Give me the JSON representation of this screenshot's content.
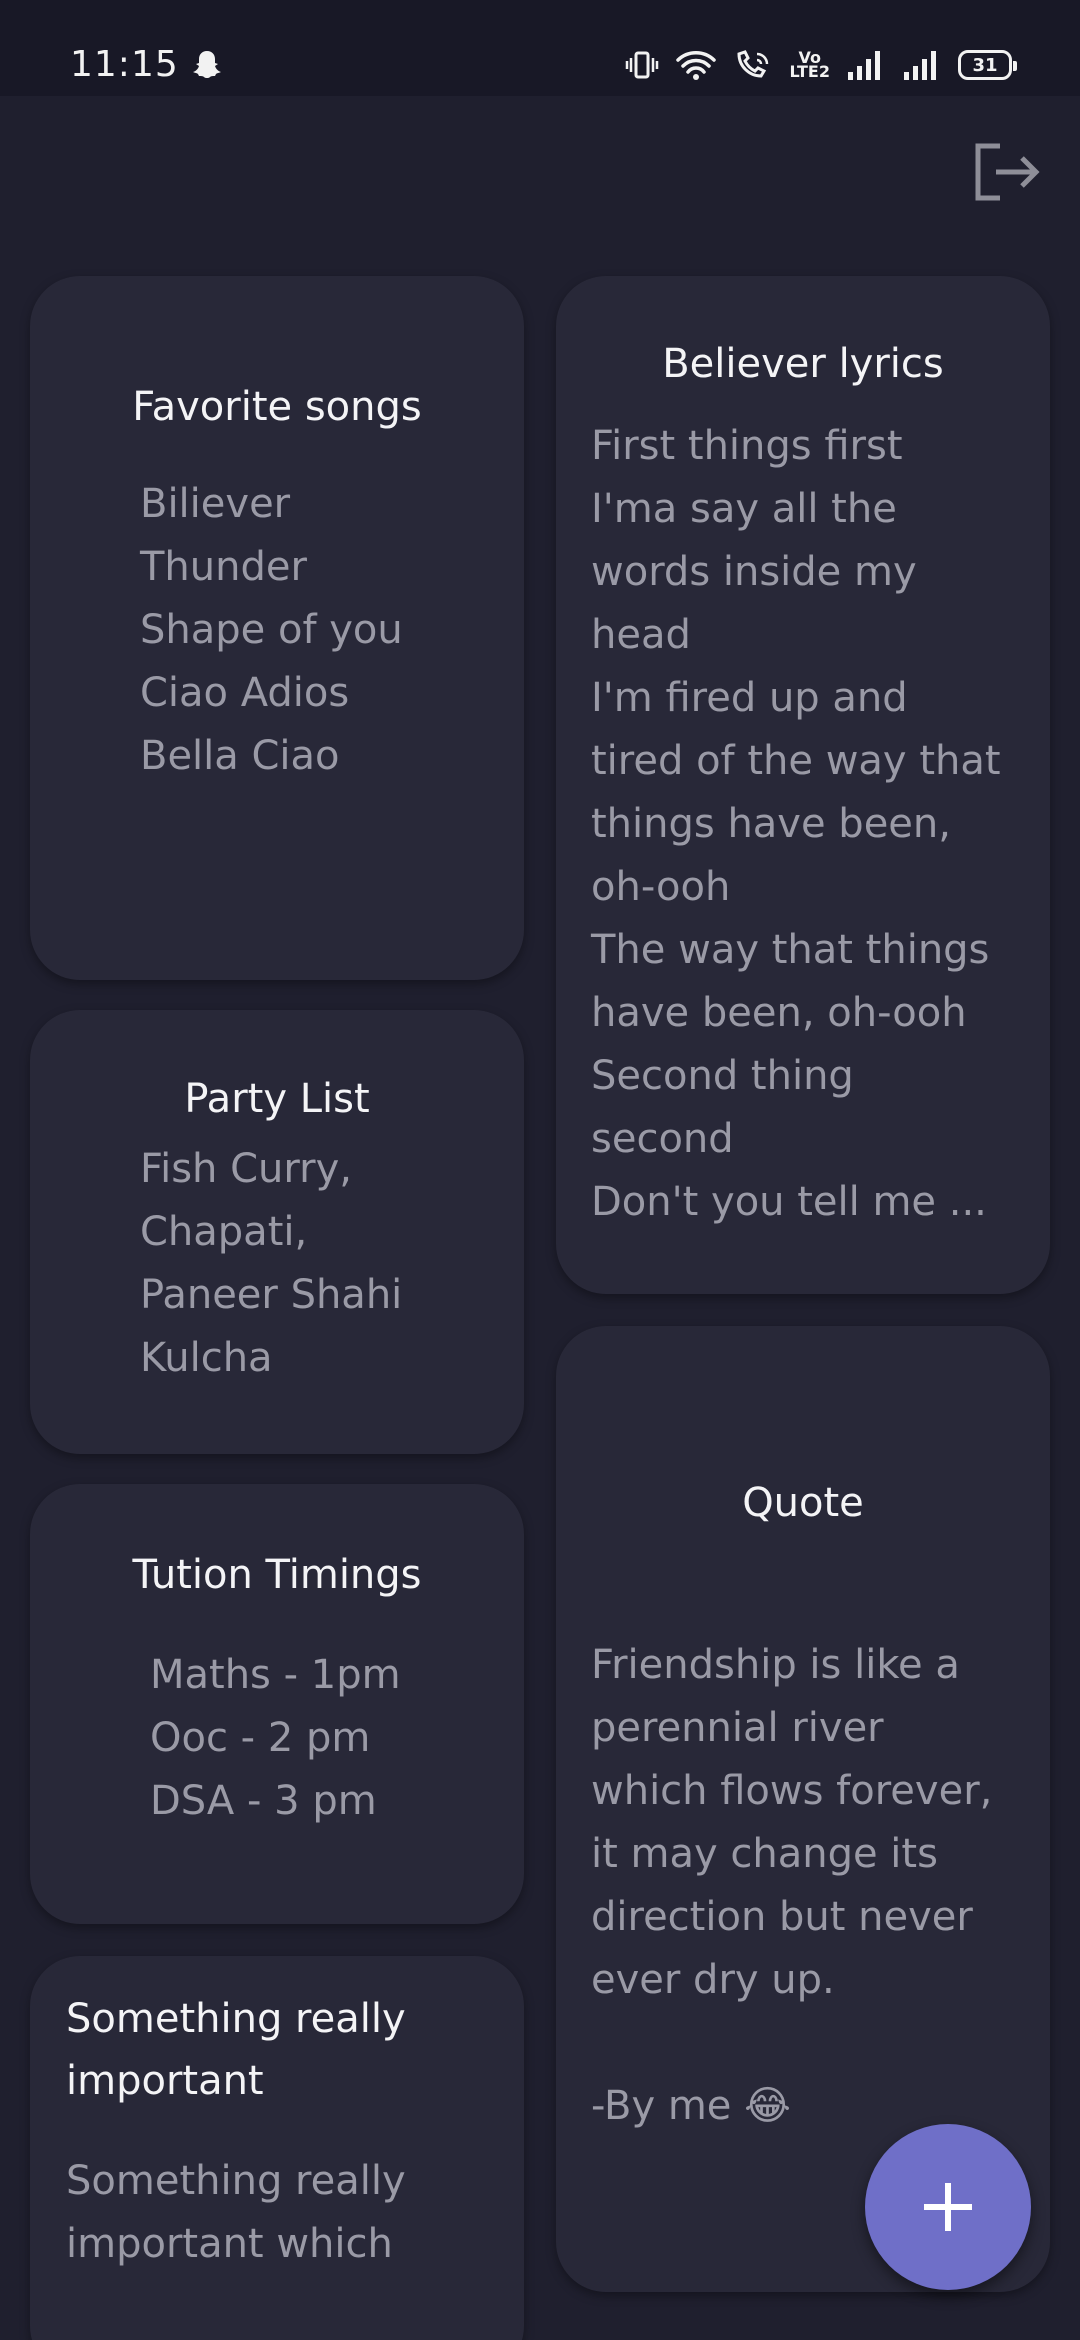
{
  "status_bar": {
    "time": "11:15",
    "battery": "31",
    "volte": "Vo\nLTE2"
  },
  "header": {
    "logout_icon": "logout-icon"
  },
  "notes": [
    {
      "title": "Favorite songs",
      "lines": [
        "Biliever",
        "Thunder",
        "Shape of you",
        "Ciao Adios",
        "Bella Ciao"
      ]
    },
    {
      "title": "Believer lyrics",
      "lines": [
        "First things first",
        "I'ma say all the",
        "words inside my",
        "head",
        "I'm fired up and",
        "tired of the way that",
        "things have been,",
        "oh-ooh",
        "The way that things",
        "have been, oh-ooh",
        "Second thing",
        "second",
        "Don't you tell me ..."
      ]
    },
    {
      "title": "Party List",
      "lines": [
        "Fish Curry,",
        "Chapati,",
        "Paneer Shahi",
        "Kulcha"
      ]
    },
    {
      "title": "Quote",
      "lines": [
        "Friendship is like a",
        "perennial river",
        "which flows forever,",
        "it may change its",
        "direction but never",
        "ever dry up.",
        "",
        "-By me 😂"
      ]
    },
    {
      "title": "Tution Timings",
      "lines": [
        "Maths - 1pm",
        "Ooc - 2 pm",
        "DSA - 3 pm"
      ]
    },
    {
      "title": "Something really important",
      "lines": [
        "Something really",
        "important which"
      ]
    }
  ],
  "fab": {
    "icon": "plus-icon"
  },
  "colors": {
    "background": "#1f1f2e",
    "card": "#282838",
    "accent": "#6f6fc8"
  }
}
